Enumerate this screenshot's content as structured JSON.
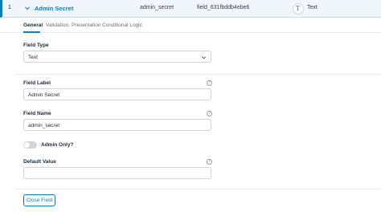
{
  "field_row": {
    "order": "1",
    "label": "Admin Secret",
    "name": "admin_secret",
    "key": "field_631fbddb4ebe6",
    "type": "Text",
    "type_icon": "T"
  },
  "tabs": [
    {
      "label": "General",
      "active": true
    },
    {
      "label": "Validation",
      "active": false
    },
    {
      "label": "Presentation",
      "active": false
    },
    {
      "label": "Conditional Logic",
      "active": false
    }
  ],
  "settings": {
    "field_type_label": "Field Type",
    "field_type_value": "Text",
    "field_label_label": "Field Label",
    "field_label_value": "Admin Secret",
    "field_name_label": "Field Name",
    "field_name_value": "admin_secret",
    "admin_only_label": "Admin Only?",
    "admin_only_on": false,
    "default_value_label": "Default Value",
    "default_value_value": "",
    "help_glyph": "?"
  },
  "footer": {
    "close_label": "Close Field"
  },
  "colors": {
    "accent": "#0783be",
    "header_bg": "#f0f6fc"
  }
}
